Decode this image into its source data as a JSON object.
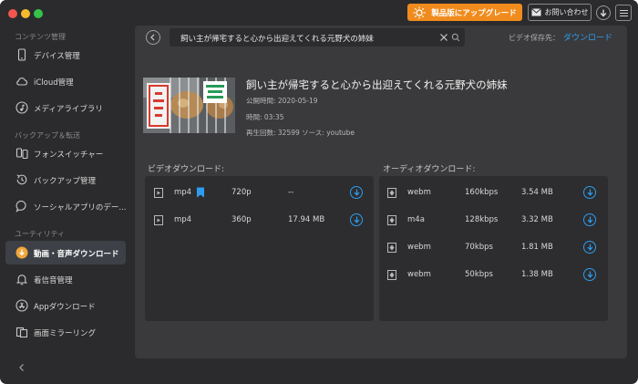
{
  "toolbar": {
    "upgrade_label": "製品版にアップグレード",
    "contact_label": "お問い合わせ"
  },
  "sidebar": {
    "sections": [
      {
        "title": "コンテンツ管理",
        "items": [
          {
            "label": "デバイス管理",
            "icon": "phone-icon"
          },
          {
            "label": "iCloud管理",
            "icon": "cloud-icon"
          },
          {
            "label": "メディアライブラリ",
            "icon": "music-note-icon"
          }
        ]
      },
      {
        "title": "バックアップ＆転送",
        "items": [
          {
            "label": "フォンスイッチャー",
            "icon": "phone-switch-icon"
          },
          {
            "label": "バックアップ管理",
            "icon": "backup-icon"
          },
          {
            "label": "ソーシャルアプリのデー...",
            "icon": "chat-bubble-icon"
          }
        ]
      },
      {
        "title": "ユーティリティ",
        "items": [
          {
            "label": "動画・音声ダウンロード",
            "icon": "download-icon",
            "active": true
          },
          {
            "label": "着信音管理",
            "icon": "bell-icon"
          },
          {
            "label": "Appダウンロード",
            "icon": "app-store-icon"
          },
          {
            "label": "画面ミラーリング",
            "icon": "screen-mirror-icon"
          }
        ]
      }
    ]
  },
  "search": {
    "value": "飼い主が帰宅すると心から出迎えてくれる元野犬の姉妹"
  },
  "save_location": {
    "label": "ビデオ保存先：",
    "link": "ダウンロード"
  },
  "video": {
    "title": "飼い主が帰宅すると心から出迎えてくれる元野犬の姉妹",
    "published": "公開時間: 2020-05-19",
    "duration": "時間: 03:35",
    "views_source": "再生回数: 32599   ソース: youtube"
  },
  "video_downloads": {
    "title": "ビデオダウンロード:",
    "rows": [
      {
        "format": "mp4",
        "quality": "720p",
        "size": "--",
        "bookmarked": true
      },
      {
        "format": "mp4",
        "quality": "360p",
        "size": "17.94 MB",
        "bookmarked": false
      }
    ]
  },
  "audio_downloads": {
    "title": "オーディオダウンロード:",
    "rows": [
      {
        "format": "webm",
        "bitrate": "160kbps",
        "size": "3.54 MB"
      },
      {
        "format": "m4a",
        "bitrate": "128kbps",
        "size": "3.32 MB"
      },
      {
        "format": "webm",
        "bitrate": "70kbps",
        "size": "1.81 MB"
      },
      {
        "format": "webm",
        "bitrate": "50kbps",
        "size": "1.38 MB"
      }
    ]
  },
  "colors": {
    "accent": "#2d9df0",
    "upgrade": "#f08c1e",
    "window_bg": "#2b2b2d",
    "panel_bg": "#2d2d2f"
  }
}
